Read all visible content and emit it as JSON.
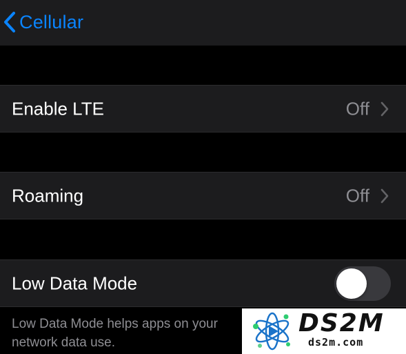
{
  "navbar": {
    "back_label": "Cellular"
  },
  "rows": {
    "enable_lte": {
      "label": "Enable LTE",
      "value": "Off"
    },
    "roaming": {
      "label": "Roaming",
      "value": "Off"
    },
    "low_data_mode": {
      "label": "Low Data Mode",
      "toggle_on": false
    }
  },
  "footer": {
    "line1": "Low Data Mode helps apps on your",
    "line2": "network data use."
  },
  "watermark": {
    "title": "DS2M",
    "subtitle": "ds2m.com"
  },
  "colors": {
    "accent": "#0a84ff",
    "cell_background": "#1c1c1e",
    "secondary_text": "#8e8e93",
    "toggle_off": "#39393d"
  },
  "icons": {
    "back": "chevron-left-icon",
    "disclosure": "chevron-right-icon"
  }
}
